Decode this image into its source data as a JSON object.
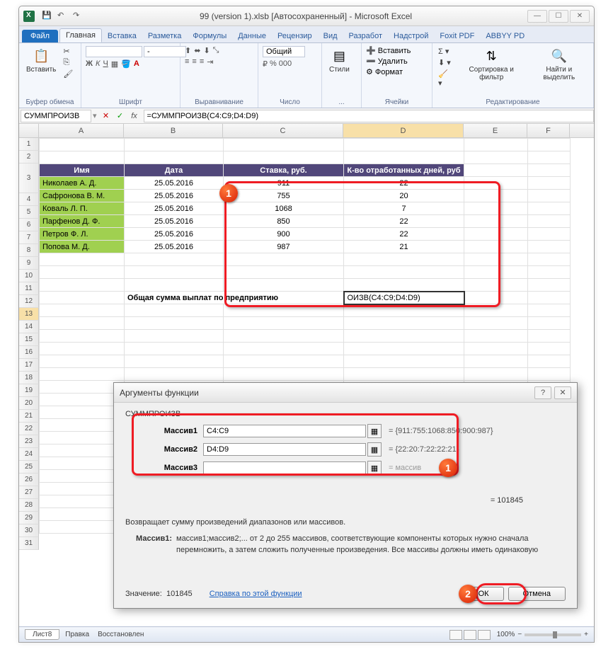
{
  "window": {
    "title": "99 (version 1).xlsb [Автосохраненный] - Microsoft Excel"
  },
  "ribbon": {
    "file": "Файл",
    "tabs": [
      "Главная",
      "Вставка",
      "Разметка",
      "Формулы",
      "Данные",
      "Рецензир",
      "Вид",
      "Разработ",
      "Надстрой",
      "Foxit PDF",
      "ABBYY PD"
    ],
    "active_tab": 0,
    "groups": {
      "clipboard": {
        "label": "Буфер обмена",
        "paste": "Вставить"
      },
      "font": {
        "label": "Шрифт",
        "size": "-"
      },
      "alignment": {
        "label": "Выравнивание"
      },
      "number": {
        "label": "Число",
        "format": "Общий"
      },
      "styles": {
        "label": "...",
        "btn": "Стили"
      },
      "cells": {
        "label": "Ячейки",
        "insert": "Вставить",
        "delete": "Удалить",
        "format": "Формат"
      },
      "editing": {
        "label": "Редактирование",
        "sort": "Сортировка и фильтр",
        "find": "Найти и выделить"
      }
    }
  },
  "formula_bar": {
    "name_box": "СУММПРОИЗВ",
    "formula": "=СУММПРОИЗВ(C4:C9;D4:D9)"
  },
  "columns": [
    "A",
    "B",
    "C",
    "D",
    "E",
    "F"
  ],
  "table": {
    "headers": [
      "Имя",
      "Дата",
      "Ставка, руб.",
      "К-во отработанных дней, руб"
    ],
    "rows": [
      {
        "name": "Николаев А. Д.",
        "date": "25.05.2016",
        "rate": "911",
        "days": "22"
      },
      {
        "name": "Сафронова В. М.",
        "date": "25.05.2016",
        "rate": "755",
        "days": "20"
      },
      {
        "name": "Коваль Л. П.",
        "date": "25.05.2016",
        "rate": "1068",
        "days": "7"
      },
      {
        "name": "Парфенов Д. Ф.",
        "date": "25.05.2016",
        "rate": "850",
        "days": "22"
      },
      {
        "name": "Петров Ф. Л.",
        "date": "25.05.2016",
        "rate": "900",
        "days": "22"
      },
      {
        "name": "Попова М. Д.",
        "date": "25.05.2016",
        "rate": "987",
        "days": "21"
      }
    ]
  },
  "row13": {
    "label": "Общая сумма выплат по предприятию",
    "cell_display": "ОИЗВ(C4:C9;D4:D9)"
  },
  "dialog": {
    "title": "Аргументы функции",
    "function": "СУММПРОИЗВ",
    "args": [
      {
        "label": "Массив1",
        "value": "C4:C9",
        "preview": "= {911:755:1068:850:900:987}"
      },
      {
        "label": "Массив2",
        "value": "D4:D9",
        "preview": "= {22:20:7:22:22:21}"
      },
      {
        "label": "Массив3",
        "value": "",
        "preview": "= массив"
      }
    ],
    "result_eq": "= 101845",
    "description": "Возвращает сумму произведений диапазонов или массивов.",
    "arg_name": "Массив1:",
    "arg_desc": "массив1;массив2;... от 2 до 255 массивов, соответствующие компоненты которых нужно сначала перемножить, а затем сложить полученные произведения. Все массивы должны иметь одинаковую",
    "value_label": "Значение:",
    "value": "101845",
    "help_link": "Справка по этой функции",
    "ok": "ОК",
    "cancel": "Отмена"
  },
  "status": {
    "sheet": "Лист8",
    "mode": "Правка",
    "recovered": "Восстановлен",
    "zoom": "100%"
  },
  "badges": {
    "b1": "1",
    "b2": "1",
    "b3": "2"
  }
}
